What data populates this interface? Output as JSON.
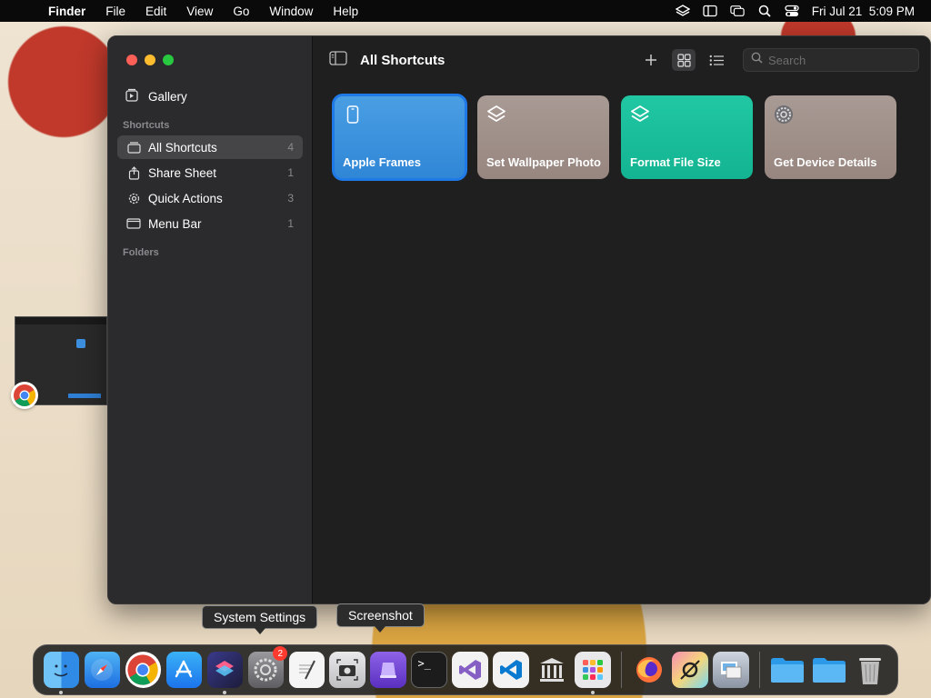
{
  "menubar": {
    "app_name": "Finder",
    "menus": [
      "File",
      "Edit",
      "View",
      "Go",
      "Window",
      "Help"
    ],
    "clock": "Fri Jul 21  5:09 PM"
  },
  "sidebar": {
    "gallery_label": "Gallery",
    "shortcuts_header": "Shortcuts",
    "folders_header": "Folders",
    "items": [
      {
        "label": "All Shortcuts",
        "count": "4",
        "icon": "all-shortcuts-icon"
      },
      {
        "label": "Share Sheet",
        "count": "1",
        "icon": "share-icon"
      },
      {
        "label": "Quick Actions",
        "count": "3",
        "icon": "gear-icon"
      },
      {
        "label": "Menu Bar",
        "count": "1",
        "icon": "menubar-icon"
      }
    ]
  },
  "toolbar": {
    "title": "All Shortcuts",
    "search_placeholder": "Search"
  },
  "shortcuts": [
    {
      "title": "Apple Frames",
      "color": "#3a93df",
      "icon": "phone-icon"
    },
    {
      "title": "Set Wallpaper Photo",
      "color": "#9d8e88",
      "icon": "shortcuts-layers-icon"
    },
    {
      "title": "Format File Size",
      "color": "#19bd9a",
      "icon": "shortcuts-layers-icon"
    },
    {
      "title": "Get Device Details",
      "color": "#9d8e88",
      "icon": "settings-gear-icon"
    }
  ],
  "tooltips": {
    "system_settings": "System Settings",
    "screenshot": "Screenshot"
  },
  "dock": {
    "system_settings_badge": "2",
    "apps": [
      "Finder",
      "Safari",
      "Chrome",
      "App Store",
      "Shortcuts",
      "System Settings",
      "TextEdit",
      "Screenshot",
      "Simulator",
      "Terminal",
      "Visual Studio",
      "VS Code",
      "Library",
      "Launchpad",
      "Firefox",
      "Xcode Tool",
      "Preview",
      "Folder",
      "Folder",
      "Trash"
    ]
  }
}
